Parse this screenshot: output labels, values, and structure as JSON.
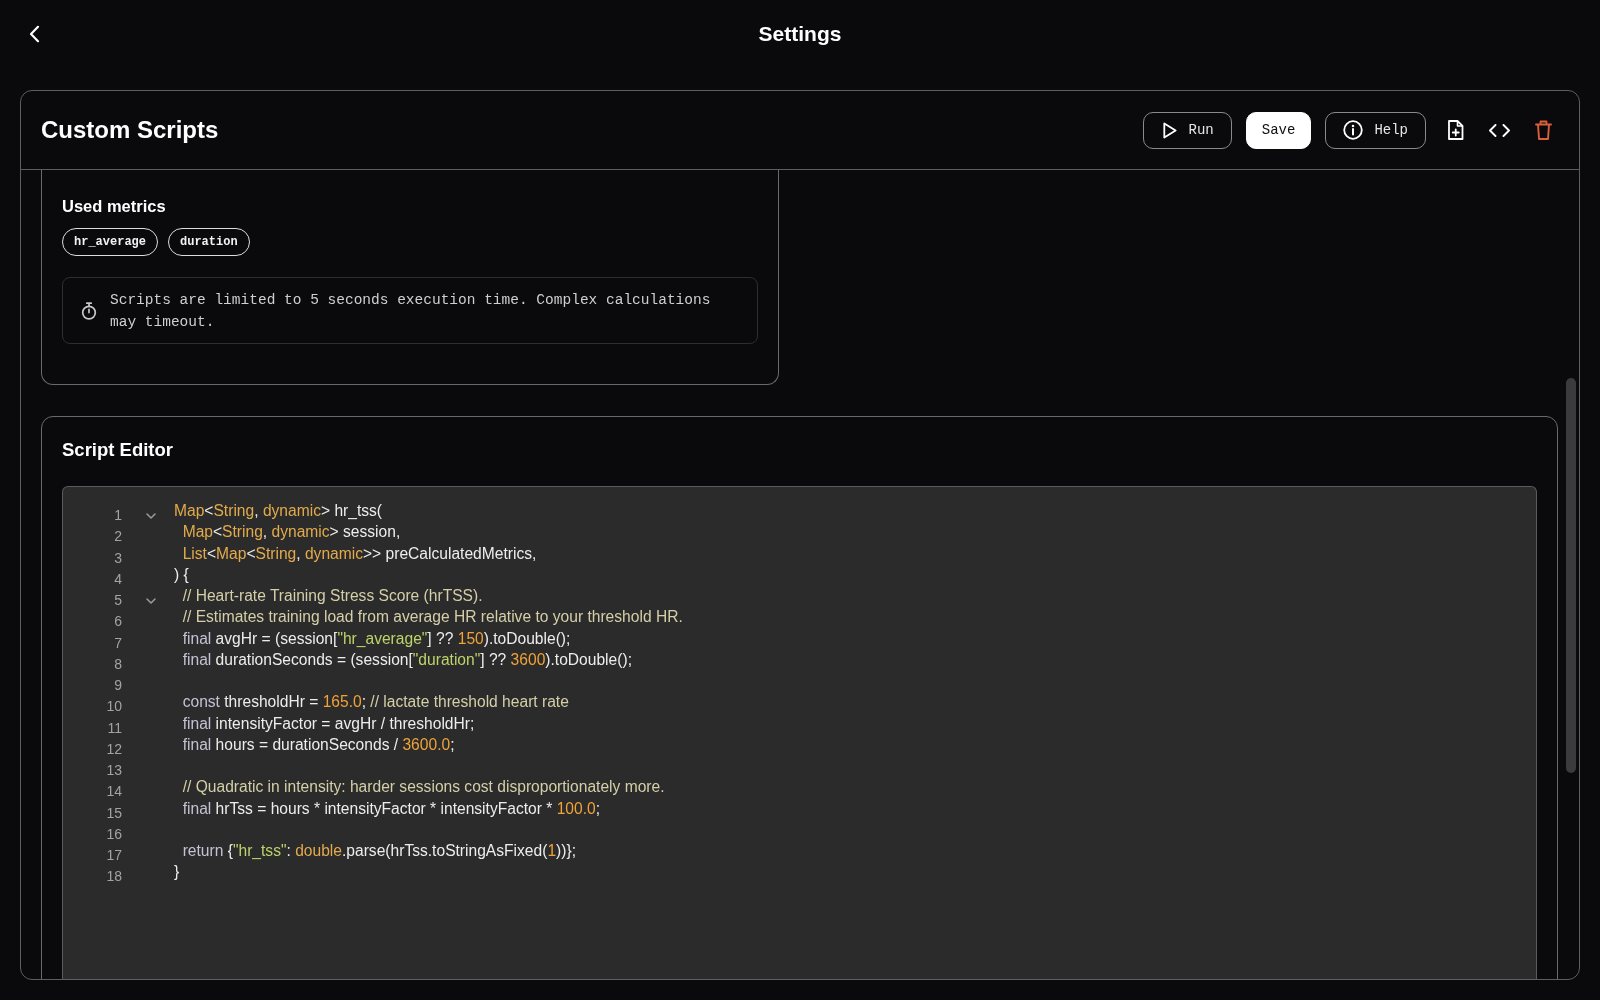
{
  "header": {
    "title": "Settings"
  },
  "panel": {
    "title": "Custom Scripts",
    "buttons": [
      {
        "label": "Run",
        "kind": "outlined"
      },
      {
        "label": "Save",
        "kind": "filled"
      },
      {
        "label": "Help",
        "kind": "outlined"
      }
    ]
  },
  "metrics_card": {
    "heading": "Used metrics",
    "metrics": [
      "hr_average",
      "duration"
    ],
    "notice": "Scripts are limited to 5 seconds execution time. Complex calculations may timeout."
  },
  "script_editor": {
    "heading": "Script Editor",
    "lines": [
      {
        "number": "1",
        "foldable": true,
        "tokens": [
          {
            "kind": "type",
            "text": "Map"
          },
          {
            "kind": "plain",
            "text": "<"
          },
          {
            "kind": "type",
            "text": "String"
          },
          {
            "kind": "plain",
            "text": ", "
          },
          {
            "kind": "type",
            "text": "dynamic"
          },
          {
            "kind": "plain",
            "text": "> hr_tss("
          }
        ]
      },
      {
        "number": "2",
        "foldable": false,
        "tokens": [
          {
            "kind": "type",
            "text": "  Map"
          },
          {
            "kind": "plain",
            "text": "<"
          },
          {
            "kind": "type",
            "text": "String"
          },
          {
            "kind": "plain",
            "text": ", "
          },
          {
            "kind": "type",
            "text": "dynamic"
          },
          {
            "kind": "plain",
            "text": "> session,"
          }
        ]
      },
      {
        "number": "3",
        "foldable": false,
        "tokens": [
          {
            "kind": "type",
            "text": "  List"
          },
          {
            "kind": "plain",
            "text": "<"
          },
          {
            "kind": "type",
            "text": "Map"
          },
          {
            "kind": "plain",
            "text": "<"
          },
          {
            "kind": "type",
            "text": "String"
          },
          {
            "kind": "plain",
            "text": ", "
          },
          {
            "kind": "type",
            "text": "dynamic"
          },
          {
            "kind": "plain",
            "text": ">> preCalculatedMetrics,"
          }
        ]
      },
      {
        "number": "4",
        "foldable": false,
        "tokens": [
          {
            "kind": "plain",
            "text": ") {"
          }
        ]
      },
      {
        "number": "5",
        "foldable": true,
        "tokens": [
          {
            "kind": "comment",
            "text": "  // Heart-rate Training Stress Score (hrTSS)."
          }
        ]
      },
      {
        "number": "6",
        "foldable": false,
        "tokens": [
          {
            "kind": "comment",
            "text": "  // Estimates training load from average HR relative to your threshold HR."
          }
        ]
      },
      {
        "number": "7",
        "foldable": false,
        "tokens": [
          {
            "kind": "keyword",
            "text": "  final"
          },
          {
            "kind": "plain",
            "text": " avgHr = (session["
          },
          {
            "kind": "string",
            "text": "\"hr_average\""
          },
          {
            "kind": "plain",
            "text": "] ?? "
          },
          {
            "kind": "number",
            "text": "150"
          },
          {
            "kind": "plain",
            "text": ").toDouble();"
          }
        ]
      },
      {
        "number": "8",
        "foldable": false,
        "tokens": [
          {
            "kind": "keyword",
            "text": "  final"
          },
          {
            "kind": "plain",
            "text": " durationSeconds = (session["
          },
          {
            "kind": "string",
            "text": "\"duration\""
          },
          {
            "kind": "plain",
            "text": "] ?? "
          },
          {
            "kind": "number",
            "text": "3600"
          },
          {
            "kind": "plain",
            "text": ").toDouble();"
          }
        ]
      },
      {
        "number": "9",
        "foldable": false
      },
      {
        "number": "10",
        "foldable": false,
        "tokens": [
          {
            "kind": "keyword",
            "text": "  const"
          },
          {
            "kind": "plain",
            "text": " thresholdHr = "
          },
          {
            "kind": "number",
            "text": "165.0"
          },
          {
            "kind": "plain",
            "text": "; "
          },
          {
            "kind": "comment",
            "text": "// lactate threshold heart rate"
          }
        ]
      },
      {
        "number": "11",
        "foldable": false,
        "tokens": [
          {
            "kind": "keyword",
            "text": "  final"
          },
          {
            "kind": "plain",
            "text": " intensityFactor = avgHr / thresholdHr;"
          }
        ]
      },
      {
        "number": "12",
        "foldable": false,
        "tokens": [
          {
            "kind": "keyword",
            "text": "  final"
          },
          {
            "kind": "plain",
            "text": " hours = durationSeconds / "
          },
          {
            "kind": "number",
            "text": "3600.0"
          },
          {
            "kind": "plain",
            "text": ";"
          }
        ]
      },
      {
        "number": "13",
        "foldable": false
      },
      {
        "number": "14",
        "foldable": false,
        "tokens": [
          {
            "kind": "comment",
            "text": "  // Quadratic in intensity: harder sessions cost disproportionately more."
          }
        ]
      },
      {
        "number": "15",
        "foldable": false,
        "tokens": [
          {
            "kind": "keyword",
            "text": "  final"
          },
          {
            "kind": "plain",
            "text": " hrTss = hours * intensityFactor * intensityFactor * "
          },
          {
            "kind": "number",
            "text": "100.0"
          },
          {
            "kind": "plain",
            "text": ";"
          }
        ]
      },
      {
        "number": "16",
        "foldable": false
      },
      {
        "number": "17",
        "foldable": false,
        "tokens": [
          {
            "kind": "keyword",
            "text": "  return"
          },
          {
            "kind": "plain",
            "text": " {"
          },
          {
            "kind": "string",
            "text": "\"hr_tss\""
          },
          {
            "kind": "plain",
            "text": ": "
          },
          {
            "kind": "type",
            "text": "double"
          },
          {
            "kind": "plain",
            "text": ".parse(hrTss.toStringAsFixed("
          },
          {
            "kind": "number",
            "text": "1"
          },
          {
            "kind": "plain",
            "text": "))};"
          }
        ]
      },
      {
        "number": "18",
        "foldable": false,
        "tokens": [
          {
            "kind": "plain",
            "text": "}"
          }
        ]
      }
    ]
  }
}
